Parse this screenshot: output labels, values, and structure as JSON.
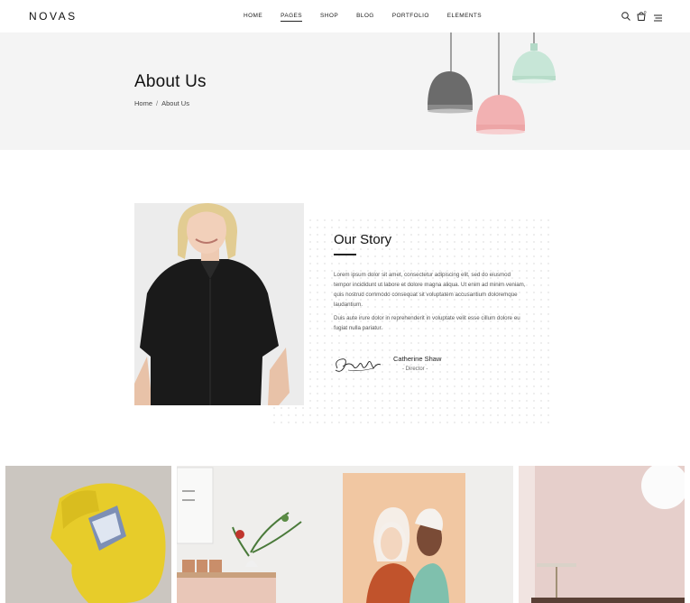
{
  "header": {
    "logo": "NOVAS",
    "nav": [
      "HOME",
      "PAGES",
      "SHOP",
      "BLOG",
      "PORTFOLIO",
      "ELEMENTS"
    ],
    "active_nav": "PAGES",
    "cart_count": "0",
    "icons": [
      "search-icon",
      "cart-icon",
      "menu-icon"
    ]
  },
  "hero": {
    "title": "About Us",
    "breadcrumb": {
      "home": "Home",
      "separator": "/",
      "current": "About Us"
    }
  },
  "story": {
    "title": "Our Story",
    "paragraph1": "Lorem ipsum dolor sit amet, consectetur adipiscing elit, sed do eiusmod tempor incididunt ut labore et dolore magna aliqua. Ut enim ad minim veniam, quis nostrud commodo consequat sit voluptatem accusantium doloremque laudantium.",
    "paragraph2": "Duis aute irure dolor in reprehenderit in voluptate velit esse cillum dolore eu fugiat nulla pariatur.",
    "author_name": "Catherine Shaw",
    "author_role": "- Director -"
  },
  "colors": {
    "hero_bg": "#f4f4f4",
    "lamp_grey": "#6b6b6b",
    "lamp_pink": "#f2b1b2",
    "lamp_mint": "#c7e6d7",
    "sofa_yellow": "#e7cc2a"
  }
}
